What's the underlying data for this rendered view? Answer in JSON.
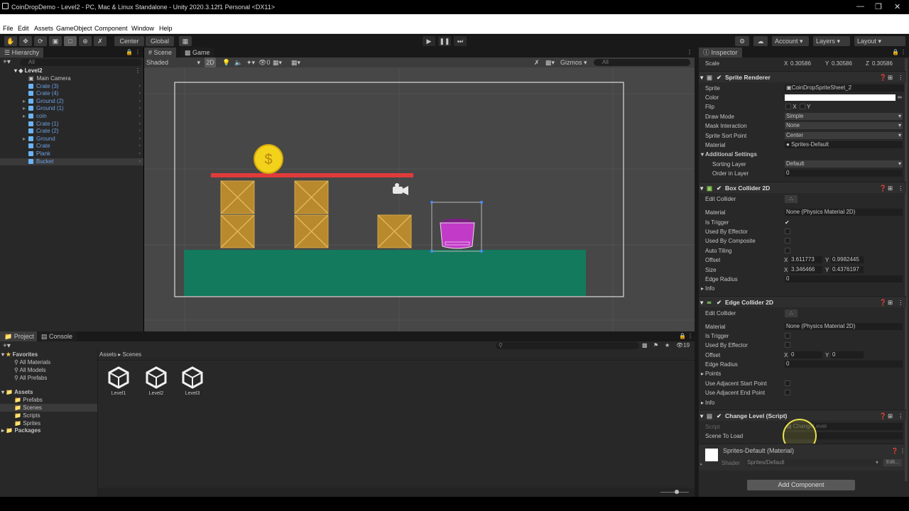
{
  "window": {
    "title": "CoinDropDemo - Level2 - PC, Mac & Linux Standalone - Unity 2020.3.12f1 Personal <DX11>"
  },
  "menu": [
    "File",
    "Edit",
    "Assets",
    "GameObject",
    "Component",
    "Window",
    "Help"
  ],
  "toolbar": {
    "pivot": "Center",
    "space": "Global",
    "account": "Account",
    "layers": "Layers",
    "layout": "Layout"
  },
  "hierarchy": {
    "tab": "Hierarchy",
    "search_placeholder": "All",
    "scene": "Level2",
    "items": [
      {
        "label": "Main Camera",
        "icon": "camera-icon"
      },
      {
        "label": "Crate (3)",
        "icon": "prefab-cube-icon"
      },
      {
        "label": "Crate (4)",
        "icon": "prefab-cube-icon"
      },
      {
        "label": "Ground (2)",
        "icon": "prefab-cube-icon"
      },
      {
        "label": "Ground (1)",
        "icon": "prefab-cube-icon"
      },
      {
        "label": "coin",
        "icon": "prefab-cube-icon"
      },
      {
        "label": "Crate (1)",
        "icon": "prefab-cube-icon"
      },
      {
        "label": "Crate (2)",
        "icon": "prefab-cube-icon"
      },
      {
        "label": "Ground",
        "icon": "prefab-cube-icon"
      },
      {
        "label": "Crate",
        "icon": "prefab-cube-icon"
      },
      {
        "label": "Plank",
        "icon": "prefab-cube-icon"
      },
      {
        "label": "Bucket",
        "icon": "prefab-cube-icon"
      }
    ]
  },
  "scene": {
    "tabs": [
      "Scene",
      "Game"
    ],
    "shading": "Shaded",
    "mode_2d": "2D",
    "hidden_count": "0",
    "gizmos": "Gizmos",
    "search_placeholder": "All",
    "colors": {
      "ground": "#137a5d",
      "plank": "#e03b3b",
      "crate": "#b98a2d",
      "coin": "#f2d21b",
      "bucket": "#c23ac8",
      "bg": "#474747"
    }
  },
  "project": {
    "tabs": [
      "Project",
      "Console"
    ],
    "favorites_label": "Favorites",
    "favorites": [
      "All Materials",
      "All Models",
      "All Prefabs"
    ],
    "assets_label": "Assets",
    "asset_folders": [
      "Prefabs",
      "Scenes",
      "Scripts",
      "Sprites"
    ],
    "packages_label": "Packages",
    "breadcrumb": [
      "Assets",
      "Scenes"
    ],
    "count": "19",
    "files": [
      "Level1",
      "Level2",
      "Level3"
    ]
  },
  "inspector": {
    "tab": "Inspector",
    "scale": {
      "label": "Scale",
      "x": "0.30586",
      "y": "0.30586",
      "z": "0.30586"
    },
    "sprite_renderer": {
      "title": "Sprite Renderer",
      "rows": [
        {
          "label": "Sprite",
          "value": "CoinDropSpriteSheet_2"
        },
        {
          "label": "Color",
          "value": ""
        },
        {
          "label": "Flip",
          "value": ""
        },
        {
          "label": "Draw Mode",
          "value": "Simple"
        },
        {
          "label": "Mask Interaction",
          "value": "None"
        },
        {
          "label": "Sprite Sort Point",
          "value": "Center"
        },
        {
          "label": "Material",
          "value": "Sprites-Default"
        }
      ],
      "flip_x": "X",
      "flip_y": "Y",
      "additional_settings": "Additional Settings",
      "sorting_layer_label": "Sorting Layer",
      "sorting_layer_value": "Default",
      "order_label": "Order in Layer",
      "order_value": "0"
    },
    "box_collider": {
      "title": "Box Collider 2D",
      "edit_collider": "Edit Collider",
      "material_label": "Material",
      "material_value": "None (Physics Material 2D)",
      "is_trigger": "Is Trigger",
      "used_by_effector": "Used By Effector",
      "used_by_composite": "Used By Composite",
      "auto_tiling": "Auto Tiling",
      "offset_label": "Offset",
      "offset_x": "3.611773",
      "offset_y": "0.9982445",
      "size_label": "Size",
      "size_x": "3.346466",
      "size_y": "0.4376197",
      "edge_radius_label": "Edge Radius",
      "edge_radius": "0",
      "info": "Info"
    },
    "edge_collider": {
      "title": "Edge Collider 2D",
      "edit_collider": "Edit Collider",
      "material_label": "Material",
      "material_value": "None (Physics Material 2D)",
      "is_trigger": "Is Trigger",
      "used_by_effector": "Used By Effector",
      "offset_label": "Offset",
      "offset_x": "0",
      "offset_y": "0",
      "edge_radius_label": "Edge Radius",
      "edge_radius": "0",
      "points": "Points",
      "use_adj_start": "Use Adjacent Start Point",
      "use_adj_end": "Use Adjacent End Point",
      "info": "Info"
    },
    "change_level": {
      "title": "Change Level (Script)",
      "script_label": "Script",
      "script_value": "ChangeLevel",
      "scene_to_load": "Scene To Load"
    },
    "material": {
      "name": "Sprites-Default (Material)",
      "shader_label": "Shader",
      "shader_value": "Sprites/Default",
      "edit": "Edit..."
    },
    "add_component": "Add Component"
  }
}
